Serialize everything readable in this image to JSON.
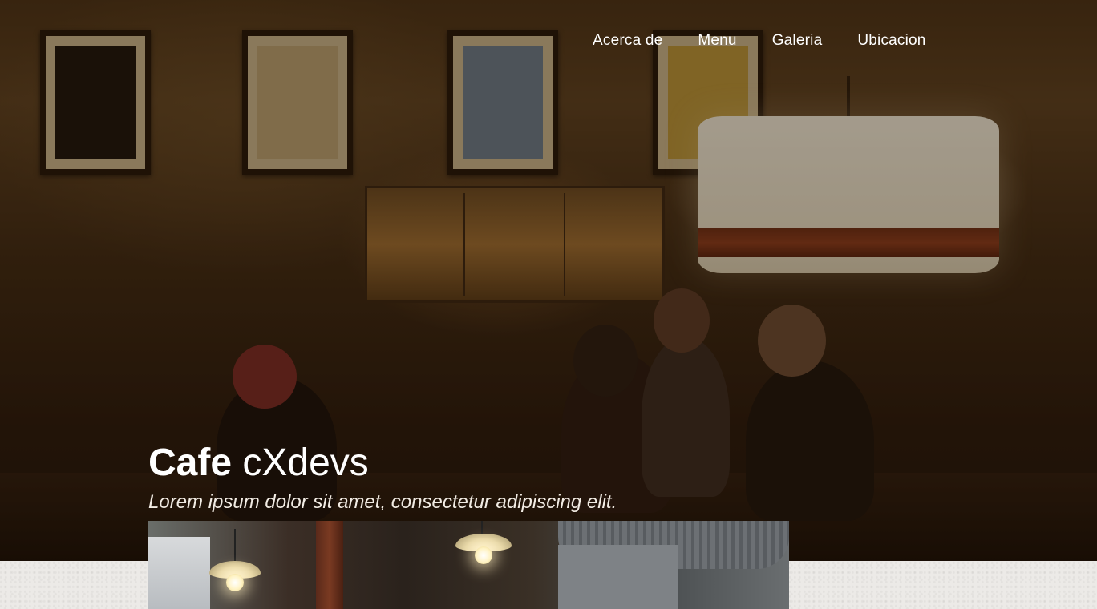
{
  "nav": {
    "items": [
      {
        "label": "Acerca de"
      },
      {
        "label": "Menu"
      },
      {
        "label": "Galeria"
      },
      {
        "label": "Ubicacion"
      }
    ]
  },
  "hero": {
    "title_bold": "Cafe",
    "title_light": "cXdevs",
    "tagline": "Lorem ipsum dolor sit amet, consectetur adipiscing elit."
  },
  "colors": {
    "hero_overlay": "#160b03",
    "text": "#ffffff",
    "lamp_band": "#8a3b1c",
    "section_background": "#eceae7"
  }
}
